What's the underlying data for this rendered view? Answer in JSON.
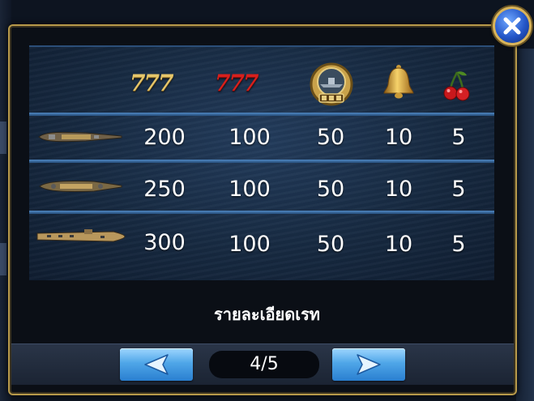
{
  "paytable": {
    "header_symbols": [
      "gold-777",
      "red-777",
      "bonus-coin",
      "bell",
      "cherry"
    ],
    "header_text": {
      "gold_777": "777",
      "red_777": "777"
    },
    "rows": [
      {
        "symbol": "small-ship",
        "payouts": [
          "200",
          "100",
          "50",
          "10",
          "5"
        ]
      },
      {
        "symbol": "battleship",
        "payouts": [
          "250",
          "100",
          "50",
          "10",
          "5"
        ]
      },
      {
        "symbol": "aircraft-carrier",
        "payouts": [
          "300",
          "100",
          "50",
          "10",
          "5"
        ]
      }
    ]
  },
  "title": "รายละเอียดเรท",
  "pager": {
    "page": "4/5"
  },
  "colors": {
    "nav_button": "#4fa6e8",
    "close_button": "#2456c8",
    "frame_gold": "#b89a4a",
    "divider": "#4f86c0"
  },
  "icons": {
    "close": "close-icon",
    "prev": "arrow-left-icon",
    "next": "arrow-right-icon"
  }
}
